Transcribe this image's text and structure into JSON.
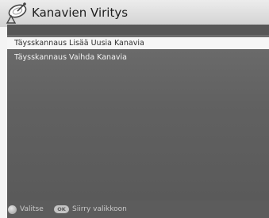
{
  "header": {
    "title": "Kanavien Viritys",
    "icon": "satellite-dish-icon"
  },
  "menu": {
    "items": [
      {
        "label": "Täysskannaus Lisää Uusia Kanavia",
        "selected": true
      },
      {
        "label": "Täysskannaus Vaihda Kanavia",
        "selected": false
      }
    ]
  },
  "footer": {
    "select_icon": "navigation-dial-icon",
    "select_label": "Valitse",
    "ok_badge": "OK",
    "ok_label": "Siirry valikkoon"
  },
  "colors": {
    "header_background": "#dcdcdc",
    "panel_background": "#636363",
    "selected_row_background": "#f6f6f6",
    "menu_text": "#f2f2f2",
    "footer_text": "#c9c9c9"
  }
}
